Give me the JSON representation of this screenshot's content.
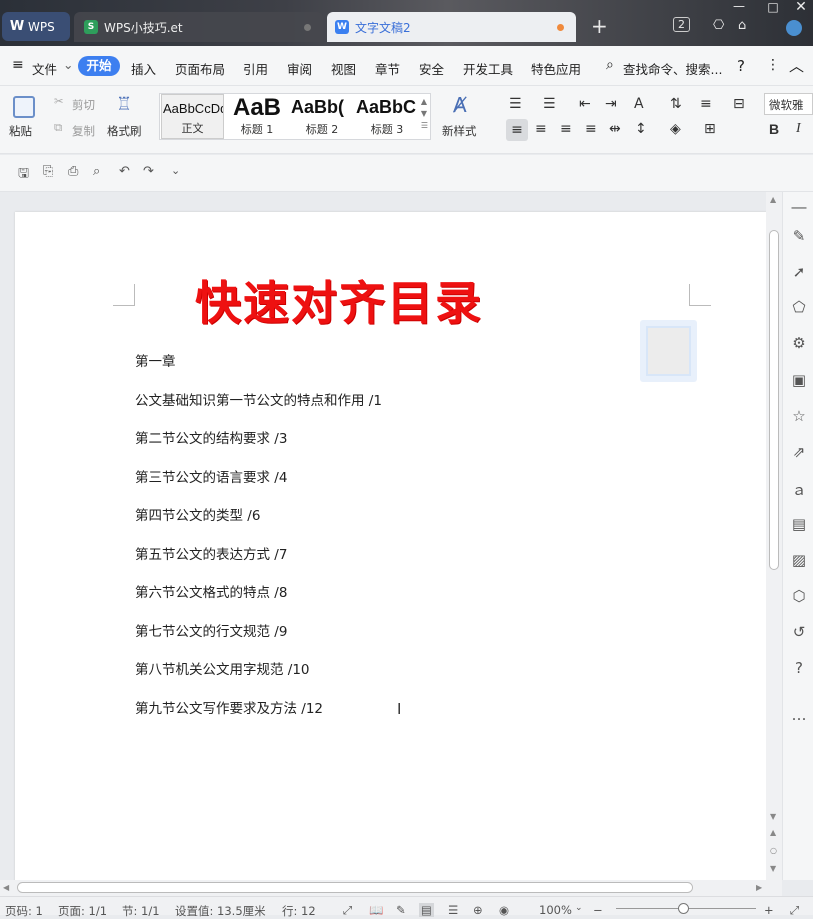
{
  "tabs": [
    {
      "label": "WPS",
      "icon": "wps-logo-icon"
    },
    {
      "label": "WPS小技巧.et",
      "icon": "spreadsheet-icon"
    },
    {
      "label": "文字文稿2",
      "icon": "document-icon"
    }
  ],
  "titlebar": {
    "badge": "2"
  },
  "menu": {
    "file": "文件",
    "start": "开始",
    "items": [
      "插入",
      "页面布局",
      "引用",
      "审阅",
      "视图",
      "章节",
      "安全",
      "开发工具",
      "特色应用"
    ],
    "search": "查找命令、搜索..."
  },
  "ribbon": {
    "paste": "粘贴",
    "cut": "剪切",
    "copy": "复制",
    "format_painter": "格式刷",
    "styles": [
      {
        "preview": "AaBbCcDd",
        "label": "正文"
      },
      {
        "preview": "AaB",
        "label": "标题 1"
      },
      {
        "preview": "AaBb(",
        "label": "标题 2"
      },
      {
        "preview": "AaBbC",
        "label": "标题 3"
      }
    ],
    "new_style": "新样式",
    "font_name": "微软雅",
    "bold": "B",
    "italic": "I"
  },
  "document": {
    "title": "快速对齐目录",
    "toc": [
      "第一章",
      "公文基础知识第一节公文的特点和作用  /1",
      "第二节公文的结构要求  /3",
      "第三节公文的语言要求  /4",
      "第四节公文的类型  /6",
      "第五节公文的表达方式  /7",
      "第六节公文格式的特点  /8",
      "第七节公文的行文规范  /9",
      "第八节机关公文用字规范  /10",
      "第九节公文写作要求及方法  /12"
    ]
  },
  "statusbar": {
    "page_num": "页码: 1",
    "pages": "页面: 1/1",
    "section": "节: 1/1",
    "setting": "设置值: 13.5厘米",
    "row": "行: 12",
    "zoom": "100%"
  },
  "colors": {
    "accent": "#3d7ff0",
    "title_red": "#ee1111",
    "doc_tab_text": "#3a6fd8"
  }
}
